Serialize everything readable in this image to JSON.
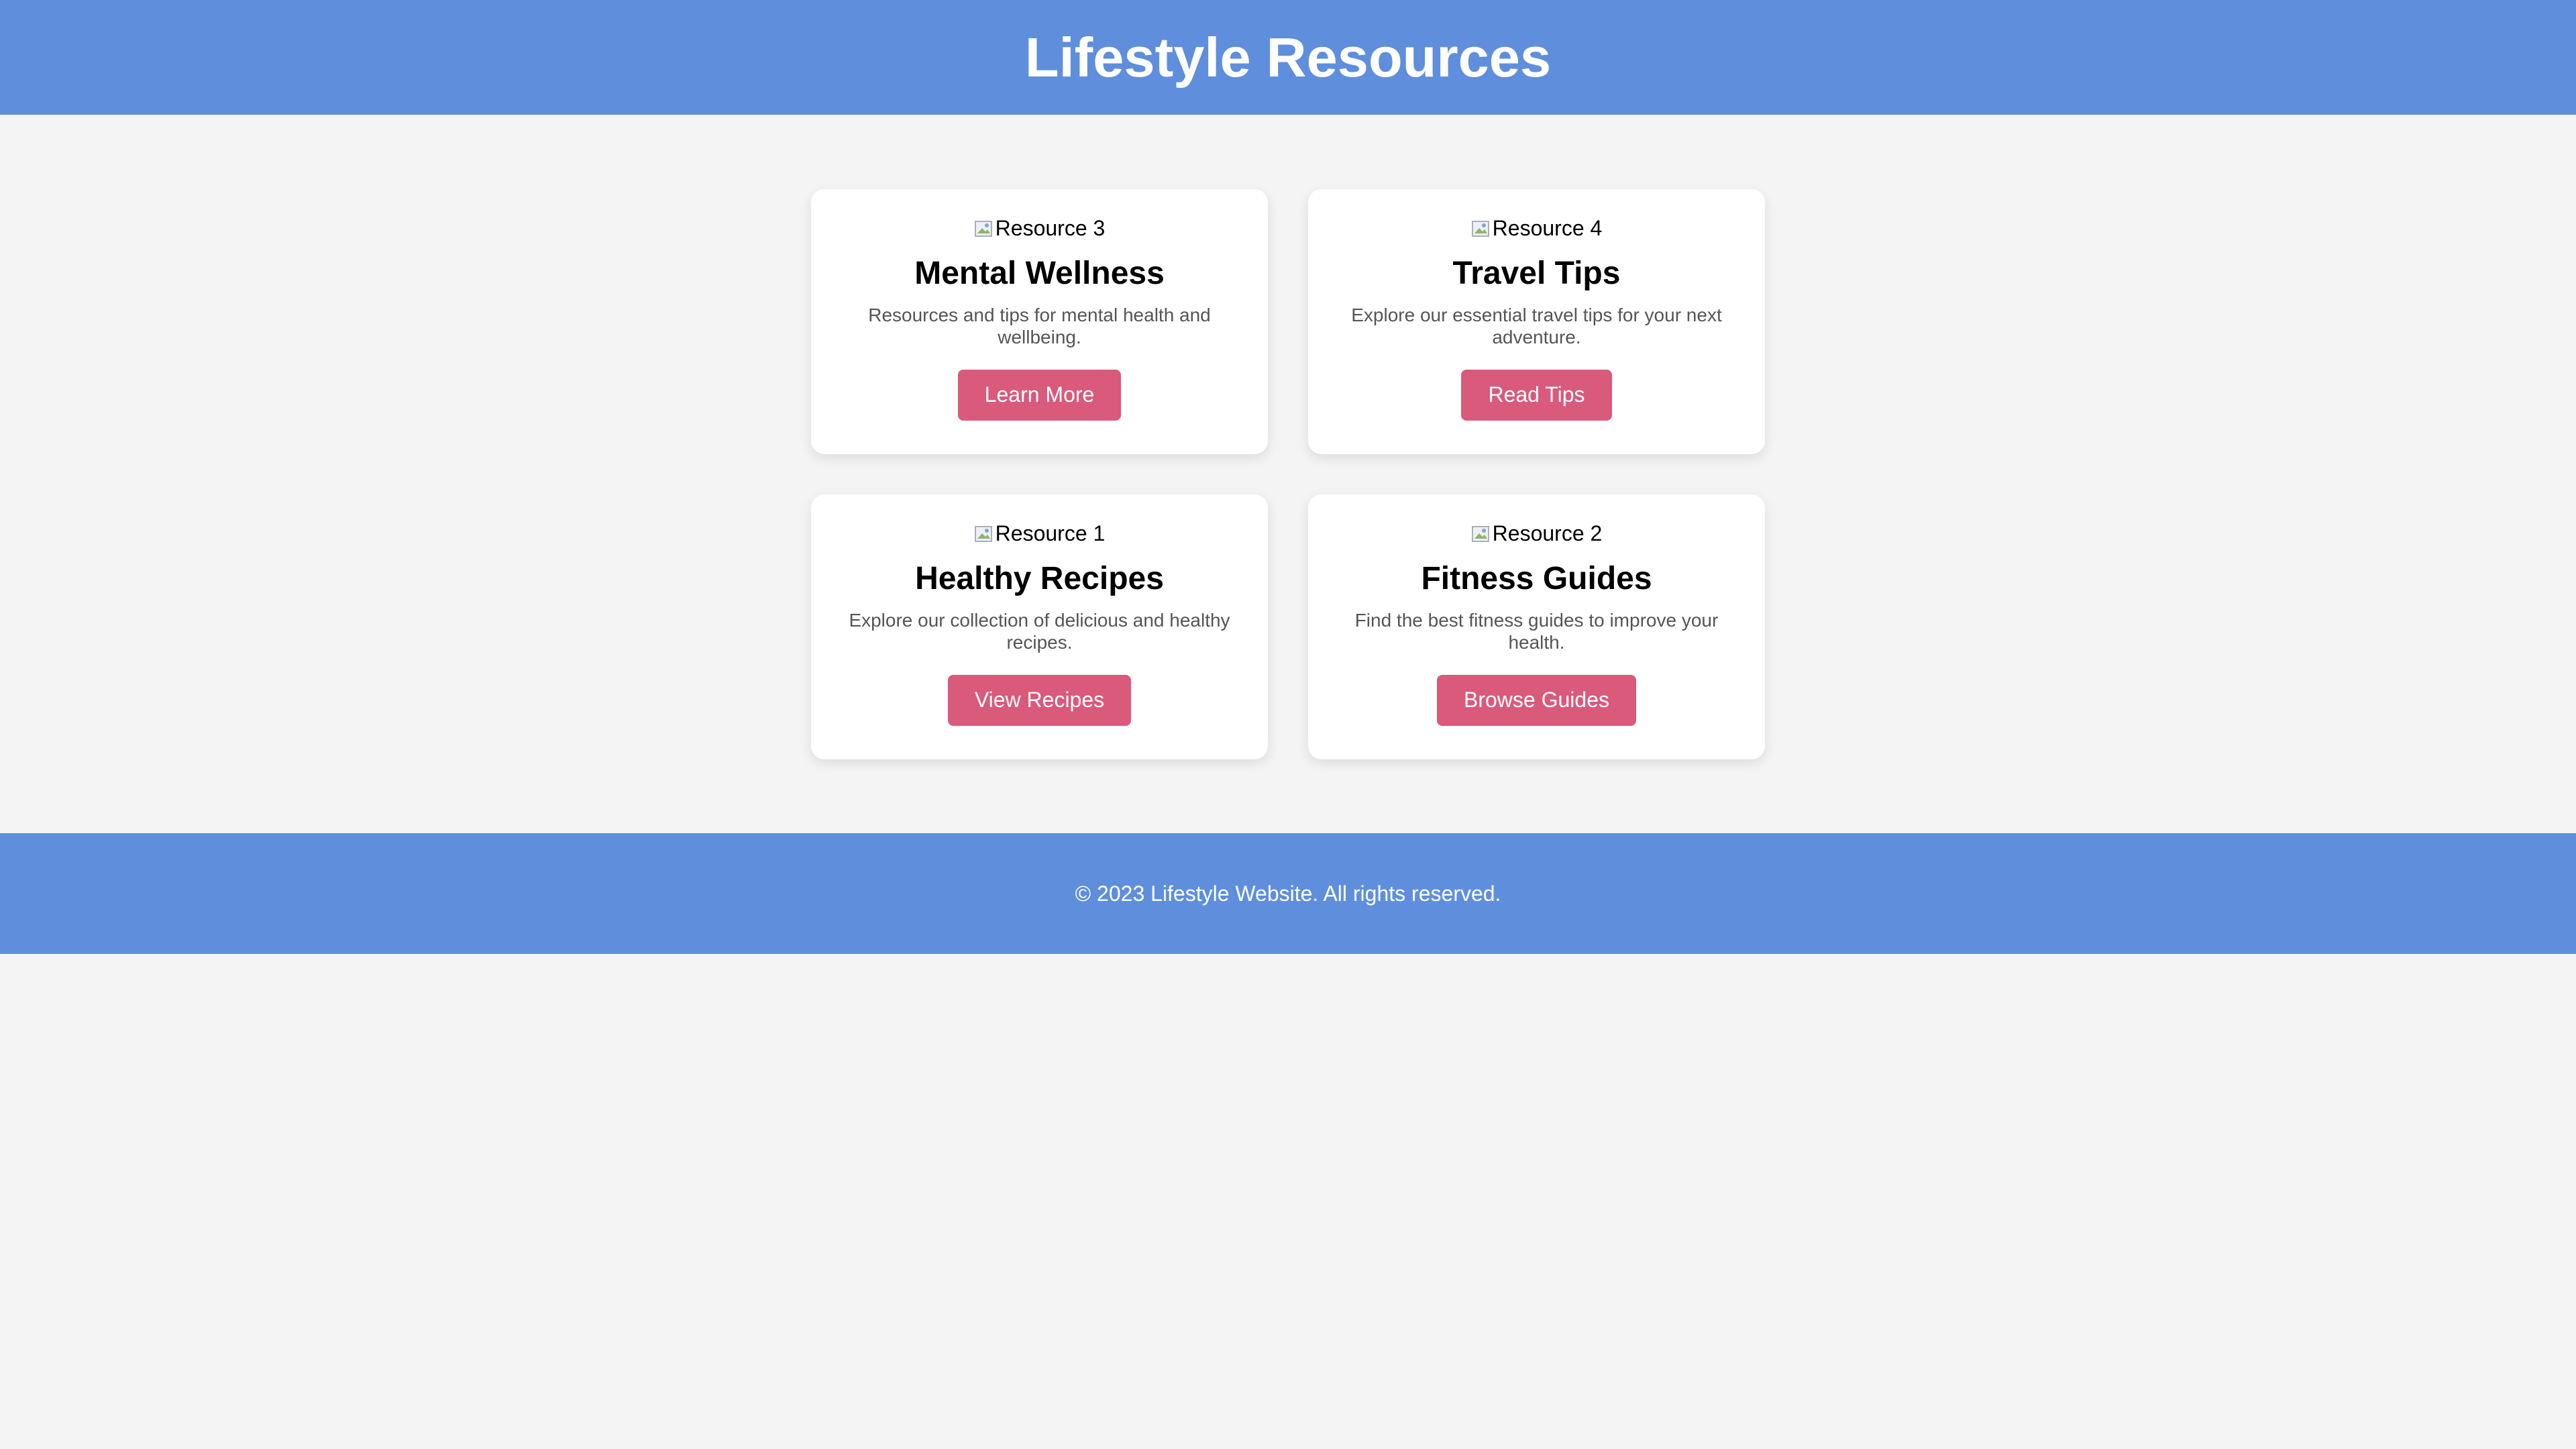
{
  "header": {
    "title": "Lifestyle Resources"
  },
  "cards": [
    {
      "image_alt": "Resource 3",
      "title": "Mental Wellness",
      "description": "Resources and tips for mental health and wellbeing.",
      "button": "Learn More"
    },
    {
      "image_alt": "Resource 4",
      "title": "Travel Tips",
      "description": "Explore our essential travel tips for your next adventure.",
      "button": "Read Tips"
    },
    {
      "image_alt": "Resource 1",
      "title": "Healthy Recipes",
      "description": "Explore our collection of delicious and healthy recipes.",
      "button": "View Recipes"
    },
    {
      "image_alt": "Resource 2",
      "title": "Fitness Guides",
      "description": "Find the best fitness guides to improve your health.",
      "button": "Browse Guides"
    }
  ],
  "footer": {
    "text": "© 2023 Lifestyle Website. All rights reserved."
  },
  "colors": {
    "header_bg": "#5f8fdc",
    "page_bg": "#f4f4f4",
    "button_bg": "#d95a7b",
    "card_bg": "#ffffff"
  },
  "icons": {
    "card_image": "broken-image-icon"
  }
}
